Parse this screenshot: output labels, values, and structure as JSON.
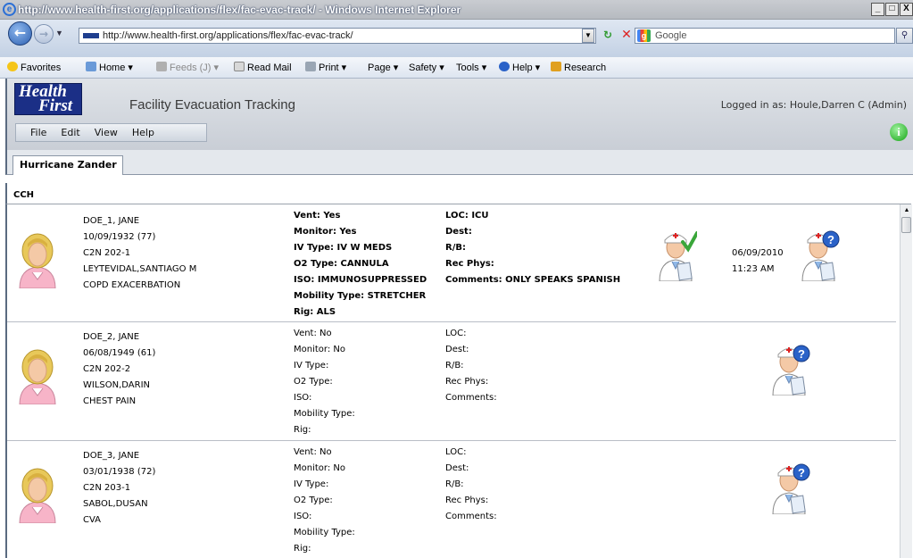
{
  "window": {
    "title": "http://www.health-first.org/applications/flex/fac-evac-track/ - Windows Internet Explorer",
    "buttons": [
      "_",
      "□",
      "X"
    ]
  },
  "address": {
    "url": "http://www.health-first.org/applications/flex/fac-evac-track/",
    "search_placeholder": "Google"
  },
  "command_bar": {
    "favorites": "Favorites",
    "home": "Home",
    "feeds": "Feeds (J)",
    "read_mail": "Read Mail",
    "print": "Print",
    "page": "Page",
    "safety": "Safety",
    "tools": "Tools",
    "help": "Help",
    "research": "Research"
  },
  "app": {
    "logo_line1": "Health",
    "logo_line2": "First",
    "title": "Facility Evacuation Tracking",
    "logged_in": "Logged in as: Houle,Darren C (Admin)",
    "menu": [
      "File",
      "Edit",
      "View",
      "Help"
    ],
    "info_icon_label": "i",
    "tab": "Hurricane Zander",
    "facility": "CCH"
  },
  "patients": [
    {
      "name": "DOE_1, JANE",
      "dob": "10/09/1932 (77)",
      "room": "C2N 202-1",
      "physician": "LEYTEVIDAL,SANTIAGO M",
      "diagnosis": "COPD EXACERBATION",
      "vent": "Vent: Yes",
      "monitor": "Monitor: Yes",
      "iv": "IV Type: IV W MEDS",
      "o2": "O2 Type: CANNULA",
      "iso": "ISO: IMMUNOSUPPRESSED",
      "mobility": "Mobility Type: STRETCHER",
      "rig": "Rig: ALS",
      "loc": "LOC: ICU",
      "dest": "Dest:",
      "rb": "R/B:",
      "rec_phys": "Rec Phys:",
      "comments": "Comments: ONLY SPEAKS SPANISH",
      "date": "06/09/2010",
      "time": "11:23 AM",
      "bold": true,
      "checked": true
    },
    {
      "name": "DOE_2, JANE",
      "dob": "06/08/1949 (61)",
      "room": "C2N 202-2",
      "physician": "WILSON,DARIN",
      "diagnosis": "CHEST PAIN",
      "vent": "Vent: No",
      "monitor": "Monitor: No",
      "iv": "IV Type:",
      "o2": "O2 Type:",
      "iso": "ISO:",
      "mobility": "Mobility Type:",
      "rig": "Rig:",
      "loc": "LOC:",
      "dest": "Dest:",
      "rb": "R/B:",
      "rec_phys": "Rec Phys:",
      "comments": "Comments:",
      "date": "",
      "time": "",
      "bold": false,
      "checked": false
    },
    {
      "name": "DOE_3, JANE",
      "dob": "03/01/1938 (72)",
      "room": "C2N 203-1",
      "physician": "SABOL,DUSAN",
      "diagnosis": "CVA",
      "vent": "Vent: No",
      "monitor": "Monitor: No",
      "iv": "IV Type:",
      "o2": "O2 Type:",
      "iso": "ISO:",
      "mobility": "Mobility Type:",
      "rig": "Rig:",
      "loc": "LOC:",
      "dest": "Dest:",
      "rb": "R/B:",
      "rec_phys": "Rec Phys:",
      "comments": "Comments:",
      "date": "",
      "time": "",
      "bold": false,
      "checked": false
    }
  ],
  "colors": {
    "logo_bg": "#1b2f86",
    "avatar_hair": "#e8c85a",
    "avatar_body": "#f7b4c8",
    "check": "#3aa63a"
  }
}
